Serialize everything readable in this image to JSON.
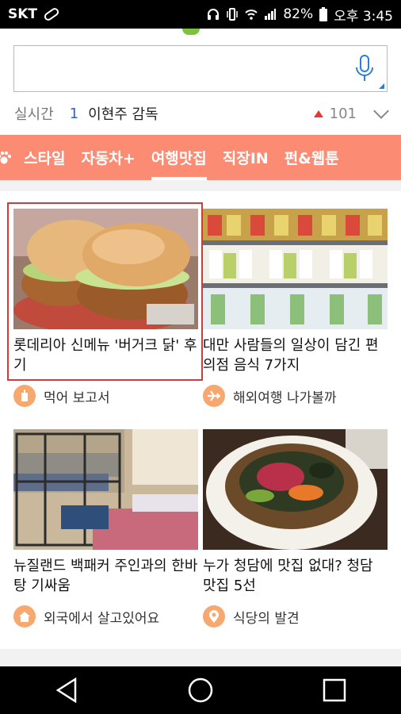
{
  "status_bar": {
    "carrier": "SKT",
    "battery_percent": "82%",
    "time": "오후 3:45"
  },
  "search": {
    "placeholder": ""
  },
  "realtime": {
    "label": "실시간",
    "rank": "1",
    "keyword": "이현주 감독",
    "count": "101"
  },
  "categories": [
    {
      "label": "스타일"
    },
    {
      "label": "자동차+"
    },
    {
      "label": "여행맛집",
      "active": true
    },
    {
      "label": "직장IN"
    },
    {
      "label": "펀&웹툰"
    }
  ],
  "cards": [
    {
      "title": "롯데리아 신메뉴 '버거크 닭' 후기",
      "source": "먹어 보고서",
      "icon": "drink-cup-icon"
    },
    {
      "title": "대만 사람들의 일상이 담긴 편의점 음식 7가지",
      "source": "해외여행 나가볼까",
      "icon": "airplane-icon"
    },
    {
      "title": "뉴질랜드 백패커 주인과의 한바탕 기싸움",
      "source": "외국에서 살고있어요",
      "icon": "house-icon"
    },
    {
      "title": "누가 청담에 맛집 없대? 청담 맛집 5선",
      "source": "식당의 발견",
      "icon": "location-pin-icon"
    }
  ],
  "colors": {
    "category_bar": "#fb8c73",
    "selected_border": "#d23b3b",
    "source_icon": "#f7a86f"
  }
}
